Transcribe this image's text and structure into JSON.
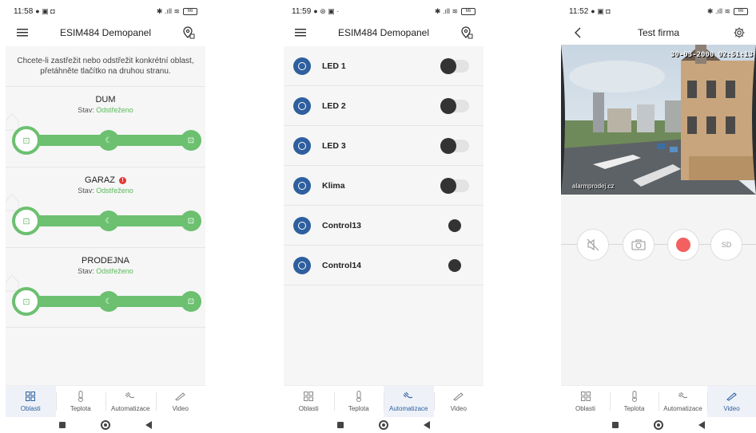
{
  "screen1": {
    "status": {
      "time": "11:58",
      "battery": "66"
    },
    "title": "ESIM484 Demopanel",
    "hint": "Chcete-li zastřežit nebo odstřežit konkrétní oblast, přetáhněte tlačítko na druhou stranu.",
    "state_prefix": "Stav:",
    "areas": [
      {
        "name": "DUM",
        "state": "Odstřeženo",
        "alert": false
      },
      {
        "name": "GARAZ",
        "state": "Odstřeženo",
        "alert": true,
        "alert_mark": "!"
      },
      {
        "name": "PRODEJNA",
        "state": "Odstřeženo",
        "alert": false
      }
    ]
  },
  "screen2": {
    "status": {
      "time": "11:59",
      "battery": "66"
    },
    "title": "ESIM484 Demopanel",
    "items": [
      {
        "label": "LED 1",
        "control": "toggle",
        "on": false
      },
      {
        "label": "LED 2",
        "control": "toggle",
        "on": false
      },
      {
        "label": "LED 3",
        "control": "toggle",
        "on": false
      },
      {
        "label": "Klima",
        "control": "toggle",
        "on": false
      },
      {
        "label": "Control13",
        "control": "button"
      },
      {
        "label": "Control14",
        "control": "button"
      }
    ]
  },
  "screen3": {
    "status": {
      "time": "11:52",
      "battery": "66"
    },
    "title": "Test firma",
    "video": {
      "timestamp": "30-03-2000 02:51:13",
      "caption": "alarmprodej.cz"
    },
    "controls": {
      "sd_label": "SD",
      "record_color": "#f26060"
    }
  },
  "tabs": {
    "labels": [
      "Oblasti",
      "Teplota",
      "Automatizace",
      "Video"
    ],
    "active": {
      "screen1": 0,
      "screen2": 2,
      "screen3": 3
    }
  },
  "colors": {
    "accent_green": "#6cc070",
    "accent_blue": "#2e5f9e",
    "record_red": "#f26060"
  }
}
